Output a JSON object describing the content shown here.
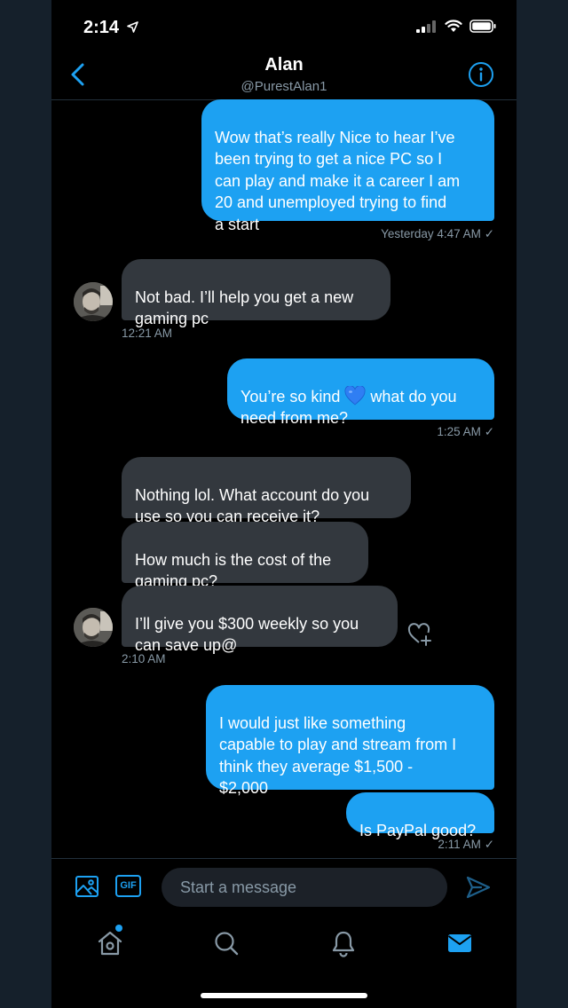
{
  "status_bar": {
    "time": "2:14"
  },
  "header": {
    "name": "Alan",
    "handle": "@PurestAlan1"
  },
  "messages": [
    {
      "text": "Wow that’s really Nice to hear I’ve\nbeen trying to get a nice PC so I\ncan play and make it a career I am\n20 and unemployed trying to find\na start",
      "direction": "outgoing"
    },
    {
      "text": "Not bad. I’ll help you get a new\ngaming pc",
      "direction": "incoming"
    },
    {
      "text_before_emoji": "You’re so kind ",
      "emoji": "blue-heart",
      "text_after_emoji": " what do you\nneed from me?",
      "direction": "outgoing"
    },
    {
      "text": "Nothing lol. What account do you\nuse so you can receive it?",
      "direction": "incoming"
    },
    {
      "text": "How much is the cost of the\ngaming pc?",
      "direction": "incoming"
    },
    {
      "text": "I’ll give you $300 weekly so you\ncan save up@",
      "direction": "incoming"
    },
    {
      "text": "I would just like something\ncapable to play and stream from I\nthink they average $1,500 -\n$2,000",
      "direction": "outgoing"
    },
    {
      "text": "Is PayPal good?",
      "direction": "outgoing"
    }
  ],
  "timestamps": [
    {
      "text": "Yesterday 4:47 AM",
      "read_check": "✓"
    },
    {
      "text": "12:21 AM"
    },
    {
      "text": "1:25 AM",
      "read_check": "✓"
    },
    {
      "text": "2:10 AM"
    },
    {
      "text": "2:11 AM",
      "read_check": "✓"
    }
  ],
  "composer": {
    "gif_label": "GIF",
    "placeholder": "Start a message"
  },
  "icons": {
    "back": "chevron-left-icon",
    "info": "info-icon",
    "media": "image-icon",
    "gif": "gif-icon",
    "send": "send-icon",
    "like": "heart-plus-icon",
    "tabs": [
      "home-icon",
      "search-icon",
      "bell-icon",
      "mail-icon"
    ]
  },
  "notifications": {
    "home_unread_dot": true
  },
  "colors": {
    "accent": "#1da1f2",
    "background": "#000000",
    "incoming_bubble": "#33383e",
    "muted_text": "#8899a6"
  }
}
